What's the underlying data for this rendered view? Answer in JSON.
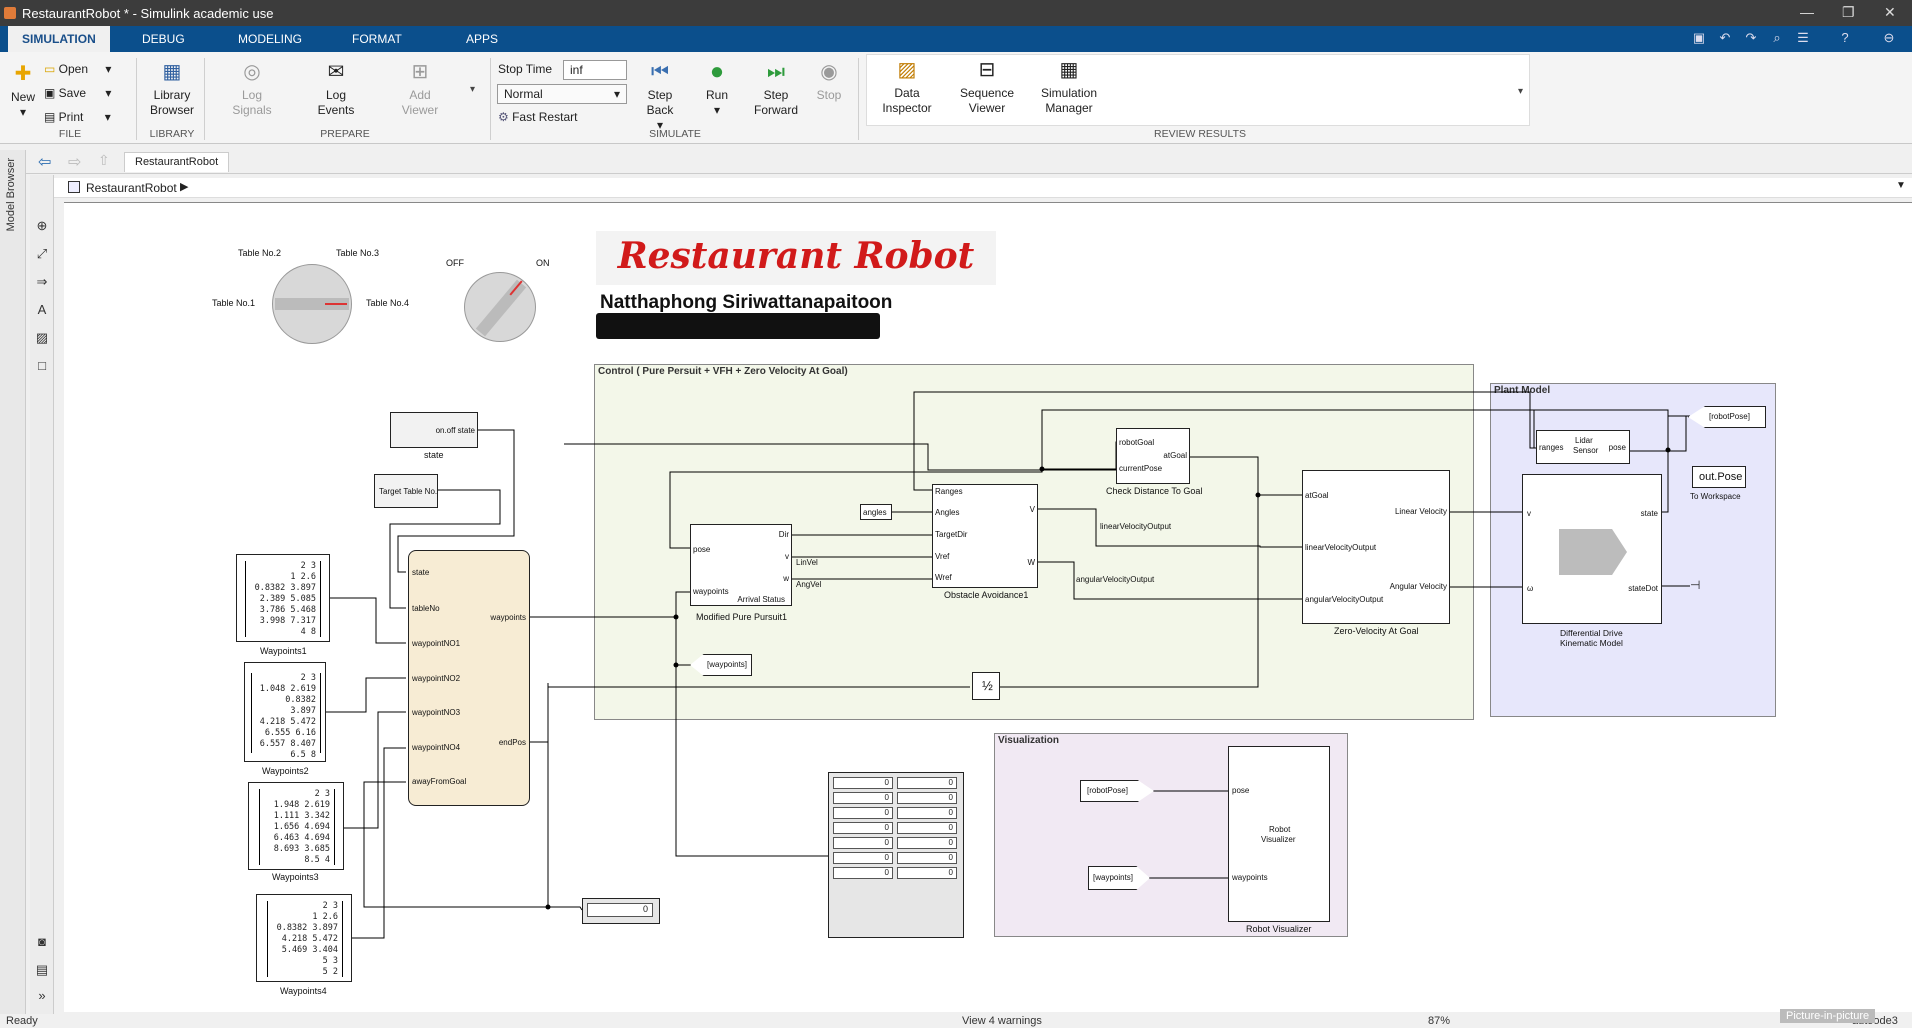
{
  "window": {
    "title": "RestaurantRobot * - Simulink academic use"
  },
  "tabs": [
    "SIMULATION",
    "DEBUG",
    "MODELING",
    "FORMAT",
    "APPS"
  ],
  "file": {
    "new": "New",
    "open": "Open",
    "save": "Save",
    "print": "Print",
    "section": "FILE"
  },
  "library": {
    "label1": "Library",
    "label2": "Browser",
    "section": "LIBRARY"
  },
  "prepare": {
    "log_signals1": "Log",
    "log_signals2": "Signals",
    "log_events1": "Log",
    "log_events2": "Events",
    "add_viewer1": "Add",
    "add_viewer2": "Viewer",
    "section": "PREPARE"
  },
  "simulate": {
    "stop_time_label": "Stop Time",
    "stop_time_value": "inf",
    "mode": "Normal",
    "fast_restart": "Fast Restart",
    "step_back1": "Step",
    "step_back2": "Back",
    "run": "Run",
    "step_forward1": "Step",
    "step_forward2": "Forward",
    "stop": "Stop",
    "section": "SIMULATE"
  },
  "review": {
    "data_inspector1": "Data",
    "data_inspector2": "Inspector",
    "sequence_viewer1": "Sequence",
    "sequence_viewer2": "Viewer",
    "sim_manager1": "Simulation",
    "sim_manager2": "Manager",
    "section": "REVIEW RESULTS"
  },
  "nav": {
    "tab": "RestaurantRobot",
    "address": "RestaurantRobot"
  },
  "left_rail": "Model Browser",
  "status": {
    "left": "Ready",
    "middle": "View 4 warnings",
    "zoom": "87%",
    "right": "autoode3",
    "pip": "Picture-in-picture"
  },
  "model": {
    "title": "Restaurant Robot",
    "author": "Natthaphong Siriwattanapaitoon",
    "knob1": {
      "labels": [
        "Table No.2",
        "Table No.3",
        "Table No.1",
        "Table No.4"
      ]
    },
    "knob2": {
      "off": "OFF",
      "on": "ON"
    },
    "blocks": {
      "state": {
        "port": "on.off state",
        "label": "state"
      },
      "target": {
        "text": "Target Table No."
      },
      "waypoints1": {
        "label": "Waypoints1",
        "rows": [
          "2      3",
          "1    2.6",
          "0.8382 3.897",
          "2.389 5.085",
          "3.786 5.468",
          "3.998 7.317",
          "4      8"
        ]
      },
      "waypoints2": {
        "label": "Waypoints2",
        "rows": [
          "2      3",
          "1.048 2.619",
          "0.8382 3.897",
          "4.218 5.472",
          "6.555   6.16",
          "6.557 8.407",
          "6.5      8"
        ]
      },
      "waypoints3": {
        "label": "Waypoints3",
        "rows": [
          "2      3",
          "1.948 2.619",
          "1.111 3.342",
          "1.656 4.694",
          "6.463 4.694",
          "8.693 3.685",
          "8.5      4"
        ]
      },
      "waypoints4": {
        "label": "Waypoints4",
        "rows": [
          "2      3",
          "1    2.6",
          "0.8382 3.897",
          "4.218 5.472",
          "5.469 3.404",
          "5      3",
          "5      2"
        ]
      },
      "selector": {
        "ports_in": [
          "state",
          "tableNo",
          "waypointNO1",
          "waypointNO2",
          "waypointNO3",
          "waypointNO4",
          "awayFromGoal"
        ],
        "ports_out": [
          "waypoints",
          "endPos"
        ]
      },
      "pursuit": {
        "label": "Modified Pure Pursuit1",
        "in": [
          "pose",
          "waypoints"
        ],
        "out": [
          "Dir",
          "v",
          "w",
          "Arrival Status"
        ],
        "extra": [
          "LinVel",
          "AngVel"
        ]
      },
      "angles": {
        "text": "angles"
      },
      "obstacle": {
        "label": "Obstacle Avoidance1",
        "in": [
          "Ranges",
          "Angles",
          "TargetDir",
          "Vref",
          "Wref"
        ],
        "out": [
          "V",
          "W"
        ]
      },
      "checkdist": {
        "label": "Check Distance To Goal",
        "in": [
          "robotGoal",
          "currentPose"
        ],
        "out": "atGoal"
      },
      "zerovel": {
        "label": "Zero-Velocity At Goal",
        "in": [
          "atGoal",
          "linearVelocityOutput",
          "angularVelocityOutput"
        ],
        "out": [
          "Linear Velocity",
          "Angular Velocity"
        ]
      },
      "lidar": {
        "text1": "Lidar",
        "text2": "Sensor",
        "in": "ranges",
        "out": "pose"
      },
      "robotpose_goto": {
        "text": "[robotPose]"
      },
      "workspace": {
        "text": "out.Pose",
        "label": "To Workspace"
      },
      "ddkm": {
        "label1": "Differential Drive",
        "label2": "Kinematic Model",
        "in": [
          "v",
          "ω"
        ],
        "out": [
          "state",
          "stateDot"
        ]
      },
      "waypoints_from": {
        "text": "[waypoints]"
      },
      "half": {
        "text": "½"
      },
      "display_scalar": {
        "value": "0"
      },
      "display_matrix": {
        "values": [
          "0",
          "0",
          "0",
          "0",
          "0",
          "0",
          "0",
          "0",
          "0",
          "0",
          "0",
          "0",
          "0",
          "0"
        ]
      },
      "visualizer": {
        "label": "Robot Visualizer",
        "text1": "Robot",
        "text2": "Visualizer",
        "in": [
          "pose",
          "waypoints"
        ],
        "src1": "[robotPose]",
        "src2": "[waypoints]"
      },
      "signals": {
        "lin_out": "linearVelocityOutput",
        "ang_out": "angularVelocityOutput"
      }
    },
    "groups": {
      "control": "Control ( Pure Persuit + VFH + Zero Velocity At Goal)",
      "plant": "Plant Model",
      "visualization": "Visualization"
    }
  }
}
